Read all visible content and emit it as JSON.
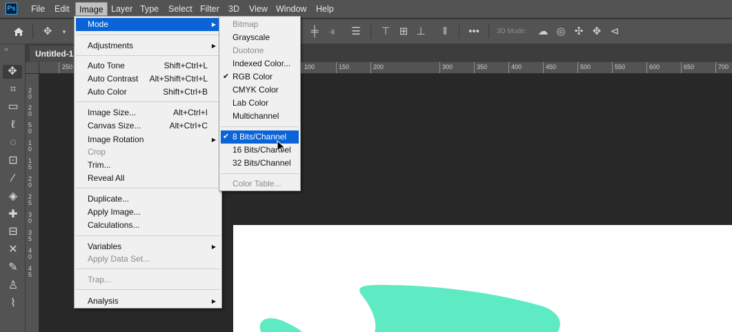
{
  "app": {
    "logo": "Ps"
  },
  "menubar": {
    "items": [
      "File",
      "Edit",
      "Image",
      "Layer",
      "Type",
      "Select",
      "Filter",
      "3D",
      "View",
      "Window",
      "Help"
    ],
    "active": "Image"
  },
  "options_bar": {
    "threed_mode_label": "3D Mode:"
  },
  "document": {
    "tab_title": "Untitled-1"
  },
  "rulers": {
    "horizontal": [
      "250",
      "100",
      "150",
      "200",
      "300",
      "350",
      "400",
      "450",
      "500",
      "550",
      "600",
      "650",
      "700"
    ],
    "vertical": [
      "20",
      "20",
      "50",
      "10",
      "15",
      "20",
      "25",
      "30",
      "35",
      "40",
      "45"
    ]
  },
  "image_menu": {
    "items": [
      {
        "label": "Mode",
        "submenu": true,
        "highlight": true
      },
      {
        "label": "Adjustments",
        "submenu": true
      },
      {
        "label": "Auto Tone",
        "shortcut": "Shift+Ctrl+L"
      },
      {
        "label": "Auto Contrast",
        "shortcut": "Alt+Shift+Ctrl+L"
      },
      {
        "label": "Auto Color",
        "shortcut": "Shift+Ctrl+B"
      },
      {
        "label": "Image Size...",
        "shortcut": "Alt+Ctrl+I"
      },
      {
        "label": "Canvas Size...",
        "shortcut": "Alt+Ctrl+C"
      },
      {
        "label": "Image Rotation",
        "submenu": true
      },
      {
        "label": "Crop",
        "disabled": true
      },
      {
        "label": "Trim..."
      },
      {
        "label": "Reveal All"
      },
      {
        "label": "Duplicate..."
      },
      {
        "label": "Apply Image..."
      },
      {
        "label": "Calculations..."
      },
      {
        "label": "Variables",
        "submenu": true
      },
      {
        "label": "Apply Data Set...",
        "disabled": true
      },
      {
        "label": "Trap...",
        "disabled": true
      },
      {
        "label": "Analysis",
        "submenu": true
      }
    ]
  },
  "mode_submenu": {
    "items": [
      {
        "label": "Bitmap",
        "disabled": true
      },
      {
        "label": "Grayscale"
      },
      {
        "label": "Duotone",
        "disabled": true
      },
      {
        "label": "Indexed Color..."
      },
      {
        "label": "RGB Color",
        "checked": true
      },
      {
        "label": "CMYK Color"
      },
      {
        "label": "Lab Color"
      },
      {
        "label": "Multichannel"
      },
      {
        "label": "8 Bits/Channel",
        "checked": true,
        "highlight": true
      },
      {
        "label": "16 Bits/Channel"
      },
      {
        "label": "32 Bits/Channel"
      },
      {
        "label": "Color Table...",
        "disabled": true
      }
    ]
  },
  "colors": {
    "accent": "#0a64d7",
    "shape": "#5eebc3",
    "ui_bg": "#535353",
    "canvas_bg": "#282828"
  }
}
